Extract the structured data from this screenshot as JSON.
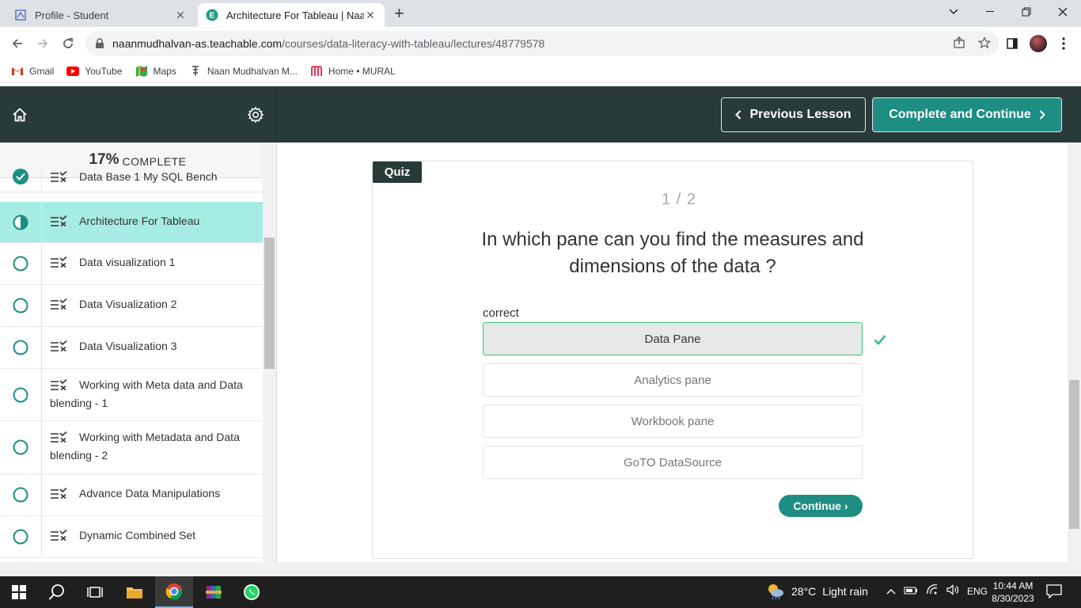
{
  "browser": {
    "tabs": [
      {
        "title": "Profile - Student",
        "active": false
      },
      {
        "title": "Architecture For Tableau | NaanMudhalvan",
        "active": true
      }
    ],
    "url_host": "naanmudhalvan-as.teachable.com",
    "url_path": "/courses/data-literacy-with-tableau/lectures/48779578",
    "bookmarks": [
      {
        "label": "Gmail",
        "icon": "gmail-icon"
      },
      {
        "label": "YouTube",
        "icon": "youtube-icon"
      },
      {
        "label": "Maps",
        "icon": "maps-icon"
      },
      {
        "label": "Naan Mudhalvan M...",
        "icon": "naan-mudhalvan-icon"
      },
      {
        "label": "Home • MURAL",
        "icon": "mural-icon"
      }
    ]
  },
  "header": {
    "prev_label": "Previous Lesson",
    "next_label": "Complete and Continue"
  },
  "sidebar": {
    "progress_pct": "17%",
    "progress_label": "complete",
    "lessons": [
      {
        "title": "Data Base 1 My SQL Bench",
        "status": "complete"
      },
      {
        "title": "Architecture For Tableau",
        "status": "in-progress"
      },
      {
        "title": "Data visualization 1",
        "status": "not-started"
      },
      {
        "title": "Data Visualization 2",
        "status": "not-started"
      },
      {
        "title": "Data Visualization 3",
        "status": "not-started"
      },
      {
        "title": "Working with Meta data and Data blending - 1",
        "status": "not-started"
      },
      {
        "title": "Working with Metadata and Data blending - 2",
        "status": "not-started"
      },
      {
        "title": "Advance Data Manipulations",
        "status": "not-started"
      },
      {
        "title": "Dynamic Combined Set",
        "status": "not-started"
      }
    ]
  },
  "quiz": {
    "tag": "Quiz",
    "counter": "1 / 2",
    "question": "In which pane can you find the measures and dimensions of the data ?",
    "feedback": "correct",
    "answers": [
      {
        "label": "Data Pane",
        "selected": true
      },
      {
        "label": "Analytics pane",
        "selected": false
      },
      {
        "label": "Workbook pane",
        "selected": false
      },
      {
        "label": "GoTO DataSource",
        "selected": false
      }
    ],
    "continue_label": "Continue ›"
  },
  "taskbar": {
    "temperature": "28°C",
    "weather": "Light rain",
    "language": "ENG",
    "time": "10:44 AM",
    "date": "8/30/2023"
  },
  "colors": {
    "header_bg": "#283b39",
    "accent": "#1e8e82",
    "current_lesson_bg": "#a7ece4",
    "correct_green": "#3bbf75"
  }
}
